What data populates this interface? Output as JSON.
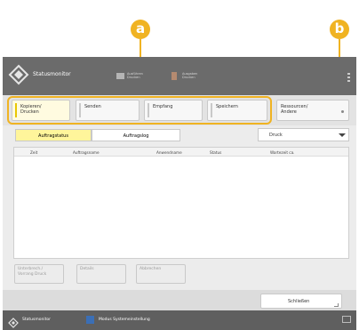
{
  "callouts": {
    "a": "a",
    "b": "b"
  },
  "header": {
    "title": "Statusmonitor",
    "btn1": "Ausführen\nDrucken",
    "btn2": "Ausgaben\nDrucken"
  },
  "tabs": [
    {
      "label": "Kopieren/\nDrucken"
    },
    {
      "label": "Senden"
    },
    {
      "label": "Empfang"
    },
    {
      "label": "Speichern"
    },
    {
      "label": "Ressourcen/\nAndere"
    }
  ],
  "segments": {
    "status": "Auftragstatus",
    "log": "Auftragslog"
  },
  "dropdown": {
    "value": "Druck"
  },
  "table": {
    "columns": [
      "Zeit",
      "Auftragsname",
      "Anwendname",
      "Status",
      "Wartezeit ca."
    ]
  },
  "buttons": {
    "details_change": "Unterbrech./\nVorrang Druck",
    "details": "Details",
    "cancel": "Abbrechen",
    "close": "Schließen"
  },
  "footer": {
    "status": "Statusmonitor",
    "msg": "Modus Systemeinstellung"
  },
  "colors": {
    "accent": "#f0b322",
    "topbar": "#6b6b6b",
    "tabmarker": "#e8c700"
  }
}
